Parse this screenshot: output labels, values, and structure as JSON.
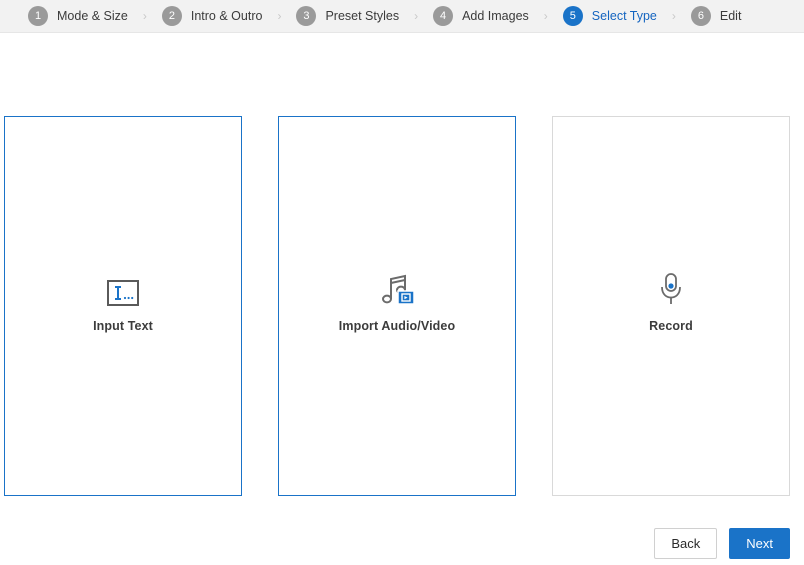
{
  "colors": {
    "accent": "#1a73c8",
    "accent_text": "#1565c0",
    "step_inactive": "#9a9a9a",
    "header_bg": "#f2f2f2",
    "card_border": "#d9d9d9",
    "icon_gray": "#6b6b6b"
  },
  "stepper": {
    "separator": "›",
    "steps": [
      {
        "number": "1",
        "label": "Mode & Size",
        "active": false
      },
      {
        "number": "2",
        "label": "Intro & Outro",
        "active": false
      },
      {
        "number": "3",
        "label": "Preset Styles",
        "active": false
      },
      {
        "number": "4",
        "label": "Add Images",
        "active": false
      },
      {
        "number": "5",
        "label": "Select Type",
        "active": true
      },
      {
        "number": "6",
        "label": "Edit",
        "active": false
      }
    ]
  },
  "cards": [
    {
      "label": "Input Text",
      "icon": "text-cursor-box-icon",
      "selected": true
    },
    {
      "label": "Import Audio/Video",
      "icon": "music-note-video-icon",
      "selected": true
    },
    {
      "label": "Record",
      "icon": "microphone-icon",
      "selected": false
    }
  ],
  "footer": {
    "back_label": "Back",
    "next_label": "Next"
  }
}
